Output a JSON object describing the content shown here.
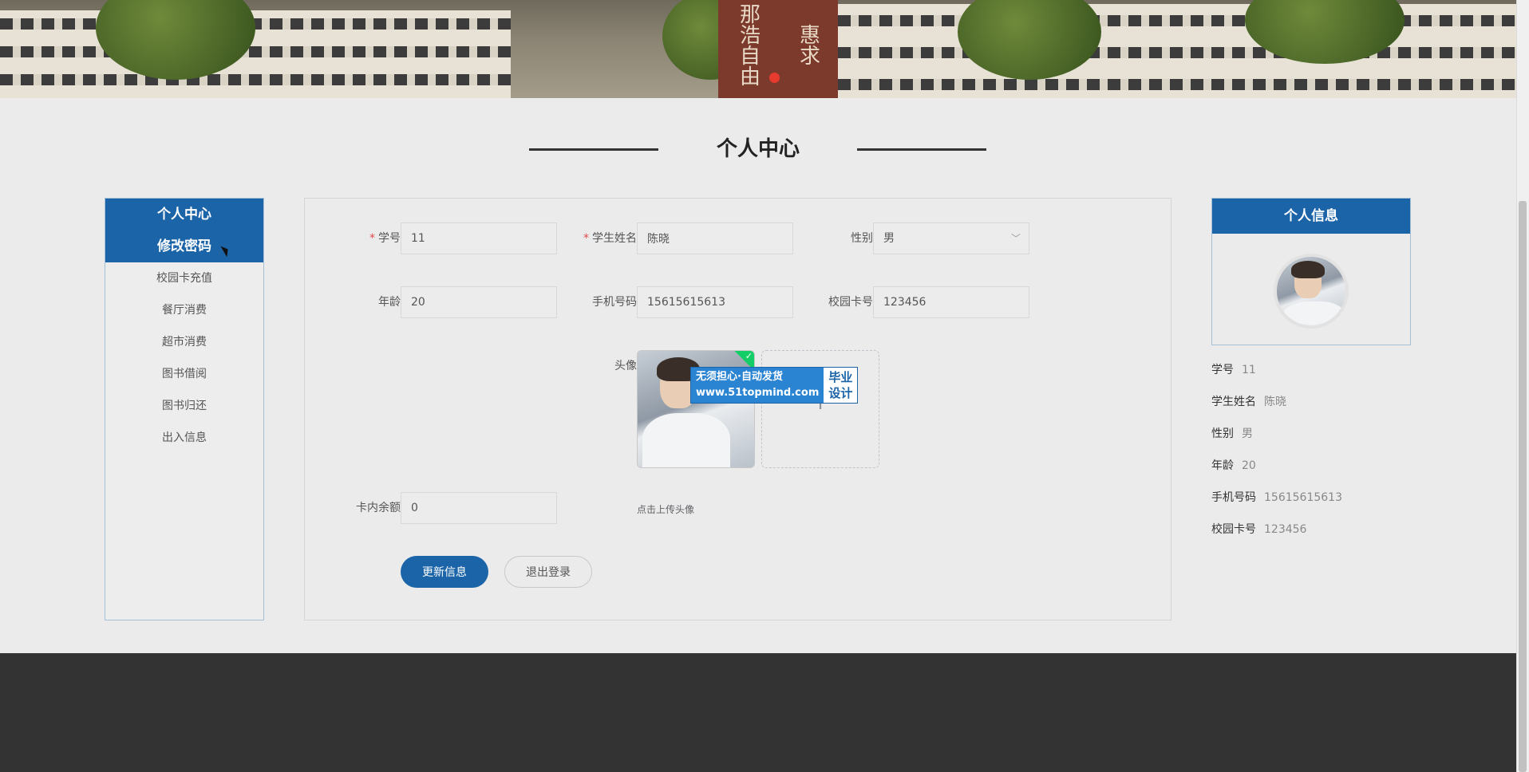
{
  "banner": {
    "sign_left": "那浩自由",
    "sign_right": "惠求"
  },
  "page": {
    "title": "个人中心"
  },
  "sidenav": {
    "items": [
      {
        "label": "个人中心",
        "active": true
      },
      {
        "label": "修改密码",
        "active": true
      },
      {
        "label": "校园卡充值"
      },
      {
        "label": "餐厅消费"
      },
      {
        "label": "超市消费"
      },
      {
        "label": "图书借阅"
      },
      {
        "label": "图书归还"
      },
      {
        "label": "出入信息"
      }
    ]
  },
  "form": {
    "student_id": {
      "label": "学号",
      "value": "11"
    },
    "student_name": {
      "label": "学生姓名",
      "value": "陈晓"
    },
    "gender": {
      "label": "性别",
      "value": "男"
    },
    "age": {
      "label": "年龄",
      "value": "20"
    },
    "phone": {
      "label": "手机号码",
      "value": "15615615613"
    },
    "card_no": {
      "label": "校园卡号",
      "value": "123456"
    },
    "avatar": {
      "label": "头像",
      "hint": "点击上传头像"
    },
    "balance": {
      "label": "卡内余额",
      "value": "0"
    },
    "update_label": "更新信息",
    "logout_label": "退出登录"
  },
  "watermark": {
    "line1": "无须担心·自动发货",
    "line2": "www.51topmind.com",
    "right1": "毕业",
    "right2": "设计"
  },
  "info": {
    "title": "个人信息",
    "rows": [
      {
        "k": "学号",
        "v": "11"
      },
      {
        "k": "学生姓名",
        "v": "陈晓"
      },
      {
        "k": "性别",
        "v": "男"
      },
      {
        "k": "年龄",
        "v": "20"
      },
      {
        "k": "手机号码",
        "v": "15615615613"
      },
      {
        "k": "校园卡号",
        "v": "123456"
      }
    ]
  },
  "colors": {
    "primary": "#1b64a8",
    "footer": "#333333",
    "required": "#e5484d",
    "success": "#13ce66"
  }
}
